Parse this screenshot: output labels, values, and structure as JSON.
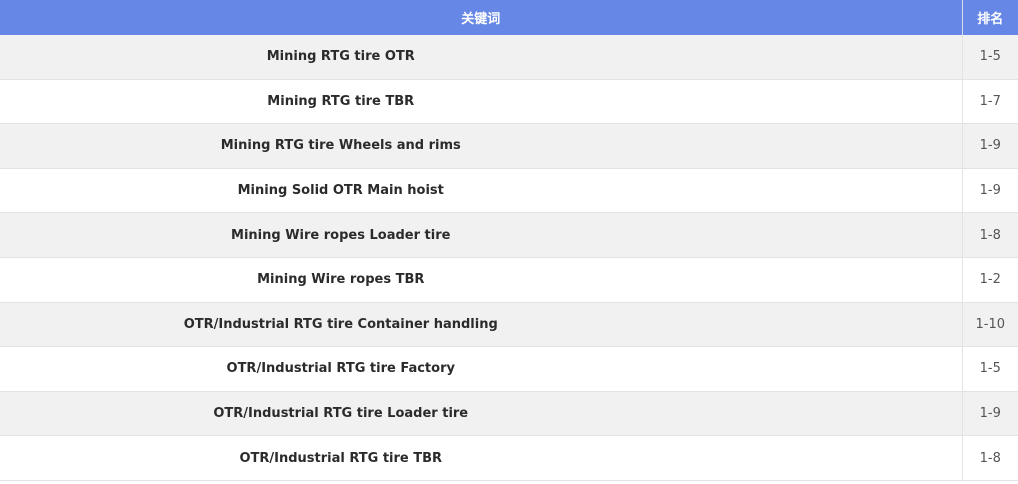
{
  "table": {
    "headers": {
      "keyword": "关键词",
      "rank": "排名"
    },
    "rows": [
      {
        "keyword": "Mining RTG tire OTR",
        "rank": "1-5"
      },
      {
        "keyword": "Mining RTG tire TBR",
        "rank": "1-7"
      },
      {
        "keyword": "Mining RTG tire Wheels and rims",
        "rank": "1-9"
      },
      {
        "keyword": "Mining Solid OTR Main hoist",
        "rank": "1-9"
      },
      {
        "keyword": "Mining Wire ropes Loader tire",
        "rank": "1-8"
      },
      {
        "keyword": "Mining Wire ropes TBR",
        "rank": "1-2"
      },
      {
        "keyword": "OTR/Industrial RTG tire Container handling",
        "rank": "1-10"
      },
      {
        "keyword": "OTR/Industrial RTG tire Factory",
        "rank": "1-5"
      },
      {
        "keyword": "OTR/Industrial RTG tire Loader tire",
        "rank": "1-9"
      },
      {
        "keyword": "OTR/Industrial RTG tire TBR",
        "rank": "1-8"
      }
    ]
  },
  "colors": {
    "header_bg": "#6787e6",
    "row_alt_bg": "#f1f1f1",
    "row_bg": "#ffffff"
  }
}
